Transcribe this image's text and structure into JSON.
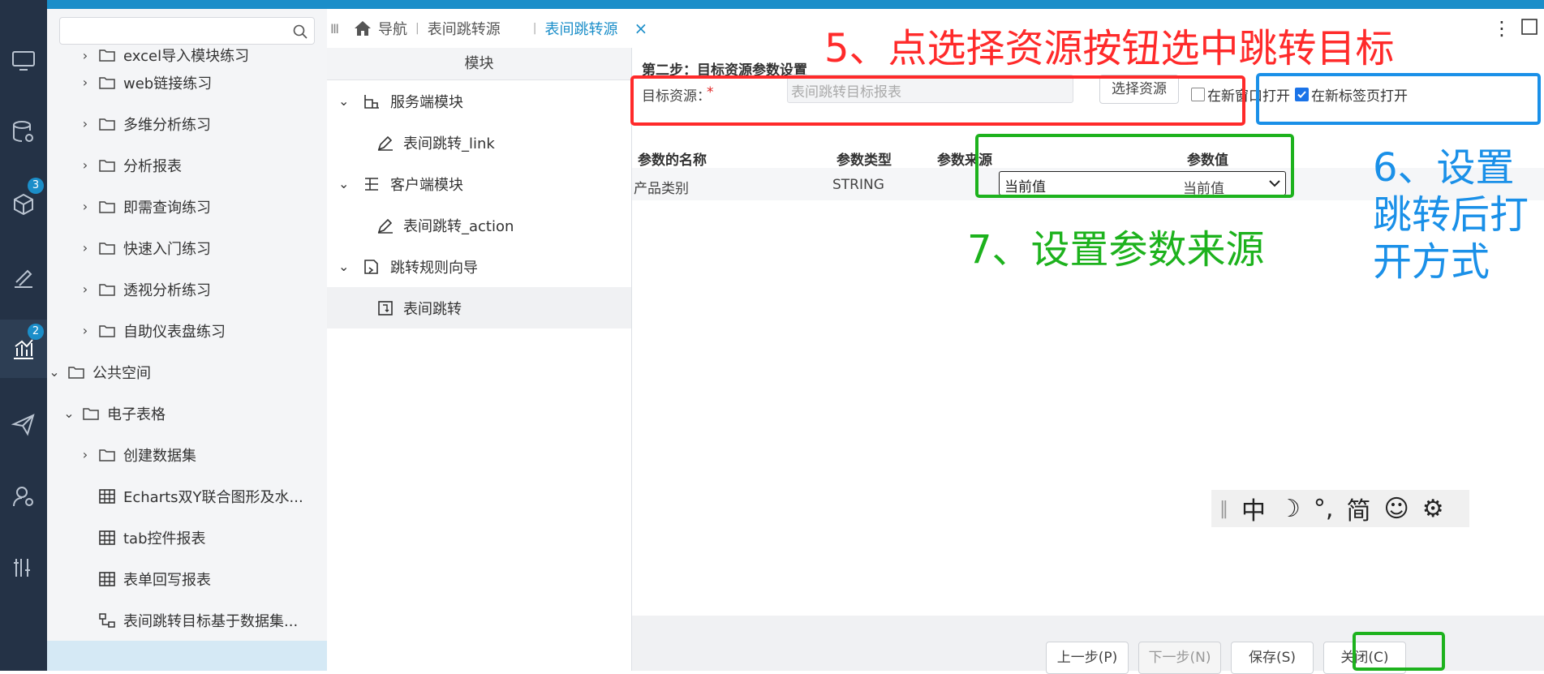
{
  "tree": {
    "search_placeholder": "",
    "items": [
      {
        "label": "excel导入模块练习",
        "arrow": "›"
      },
      {
        "label": "web链接练习",
        "arrow": "›"
      },
      {
        "label": "多维分析练习",
        "arrow": "›"
      },
      {
        "label": "分析报表",
        "arrow": "›"
      },
      {
        "label": "即需查询练习",
        "arrow": "›"
      },
      {
        "label": "快速入门练习",
        "arrow": "›"
      },
      {
        "label": "透视分析练习",
        "arrow": "›"
      },
      {
        "label": "自助仪表盘练习",
        "arrow": "›"
      },
      {
        "label": "公共空间",
        "arrow": "⌄"
      },
      {
        "label": "电子表格",
        "arrow": "⌄"
      },
      {
        "label": "创建数据集",
        "arrow": "›"
      },
      {
        "label": "Echarts双Y联合图形及水..."
      },
      {
        "label": "tab控件报表"
      },
      {
        "label": "表单回写报表"
      },
      {
        "label": "表间跳转目标基于数据集..."
      }
    ]
  },
  "rail": {
    "badge1": "3",
    "badge2": "2"
  },
  "tabs": {
    "nav": "导航",
    "tab1": "表间跳转源",
    "tab2": "表间跳转源",
    "close": "×",
    "more": "⋮"
  },
  "modules": {
    "header": "模块",
    "items": [
      {
        "label": "服务端模块"
      },
      {
        "label": "表间跳转_link"
      },
      {
        "label": "客户端模块"
      },
      {
        "label": "表间跳转_action"
      },
      {
        "label": "跳转规则向导"
      },
      {
        "label": "表间跳转"
      }
    ]
  },
  "step": {
    "title": "第二步：目标资源参数设置",
    "target_label": "目标资源：",
    "required": "*",
    "target_placeholder": "表间跳转目标报表",
    "select_button": "选择资源",
    "open_new_window": "在新窗口打开",
    "open_new_tab": "在新标签页打开",
    "table": {
      "headers": [
        "参数的名称",
        "参数类型",
        "参数来源",
        "参数值"
      ],
      "row": {
        "name": "产品类别",
        "type": "STRING",
        "source": "当前值",
        "value": "当前值"
      }
    },
    "buttons": {
      "prev": "上一步(P)",
      "next": "下一步(N)",
      "save": "保存(S)",
      "close": "关闭(C)"
    }
  },
  "annotations": {
    "a5": "5、点选择资源按钮选中跳转目标",
    "a6_1": "6、设置",
    "a6_2": "跳转后打",
    "a6_3": "开方式",
    "a7": "7、设置参数来源",
    "colors": {
      "red": "#ff2a2a",
      "blue": "#1a90e8",
      "green": "#1db21d"
    }
  },
  "ime": {
    "c1": "中",
    "c2": "☽",
    "c3": "°,",
    "c4": "简",
    "c5": "☺",
    "c6": "⚙"
  }
}
